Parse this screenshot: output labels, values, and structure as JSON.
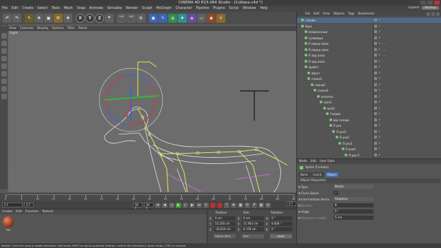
{
  "window": {
    "title": "CINEMA 4D R15.064 Studio - [Собака.c4d *]"
  },
  "menubar": [
    "File",
    "Edit",
    "Create",
    "Select",
    "Tools",
    "Mesh",
    "Snap",
    "Animate",
    "Simulate",
    "Render",
    "Sculpt",
    "MoGraph",
    "Character",
    "Pipeline",
    "Plugins",
    "Script",
    "Window",
    "Help"
  ],
  "layout": {
    "label": "Layout:",
    "value": "Startup"
  },
  "toolbar": {
    "axis_buttons": [
      "X",
      "Y",
      "Z"
    ]
  },
  "viewport": {
    "menu": [
      "View",
      "Cameras",
      "Display",
      "Options",
      "Filter",
      "Panel"
    ],
    "label": "Right"
  },
  "timeline": {
    "ticks": [
      "0",
      "5",
      "10",
      "15",
      "20",
      "25",
      "30",
      "35",
      "40",
      "45",
      "50",
      "55",
      "60",
      "65",
      "70",
      "75",
      "80",
      "85",
      "90"
    ],
    "current_frame_field": "0 F",
    "end_frame_field": "90 F",
    "start_field": "0 F",
    "max_field": "90 F",
    "right_field": "0 F"
  },
  "material_manager": {
    "menu": [
      "Create",
      "Edit",
      "Function",
      "Texture"
    ],
    "material_name": "Mat"
  },
  "coordinates": {
    "headers": [
      "Position",
      "Size",
      "Rotation"
    ],
    "axes": [
      "X",
      "Y",
      "Z"
    ],
    "position": [
      "0 cm",
      "55.256 cm",
      "-33.624 cm"
    ],
    "size": [
      "0 cm",
      "11.903 cm",
      "6.176 cm"
    ],
    "rotation_labels": [
      "H",
      "P",
      "B"
    ],
    "rotation": [
      "0 °",
      "6.628 °",
      "0 °"
    ],
    "mode_select": "Object (Rel)",
    "size_select": "Size",
    "apply_label": "Apply"
  },
  "statusbar": {
    "text": "Rotate: Click and drag to rotate elements. Hold down SHIFT to add to quantize rotation / add to the selection in point mode, CTRL to remove."
  },
  "object_manager": {
    "menu": [
      "File",
      "Edit",
      "View",
      "Objects",
      "Tags",
      "Bookmarks"
    ],
    "items": [
      {
        "name": "голова",
        "indent": 0,
        "tags": ""
      },
      {
        "name": "Root",
        "indent": 0,
        "tags": ""
      },
      {
        "name": "позвоночник",
        "indent": 1,
        "tags": ""
      },
      {
        "name": "туловище",
        "indent": 1,
        "tags": ""
      },
      {
        "name": "Л перед лапа",
        "indent": 1,
        "tags": "..."
      },
      {
        "name": "П перед лапа",
        "indent": 1,
        "tags": "..."
      },
      {
        "name": "Л зад лапа",
        "indent": 1,
        "tags": "..."
      },
      {
        "name": "П зад лапа",
        "indent": 1,
        "tags": "..."
      },
      {
        "name": "хребет",
        "indent": 1,
        "tags": ""
      },
      {
        "name": "Хвост",
        "indent": 2,
        "tags": ""
      },
      {
        "name": "спина1",
        "indent": 2,
        "tags": ""
      },
      {
        "name": "спина2",
        "indent": 3,
        "tags": ""
      },
      {
        "name": "спина3",
        "indent": 4,
        "tags": ""
      },
      {
        "name": "лопатка",
        "indent": 5,
        "tags": ""
      },
      {
        "name": "шея1",
        "indent": 6,
        "tags": ""
      },
      {
        "name": "шея2",
        "indent": 7,
        "tags": ""
      },
      {
        "name": "Голова",
        "indent": 8,
        "tags": ""
      },
      {
        "name": "low голова",
        "indent": 9,
        "tags": ""
      },
      {
        "name": "Л ухо",
        "indent": 9,
        "tags": ""
      },
      {
        "name": "Л ухо1",
        "indent": 10,
        "tags": ""
      },
      {
        "name": "Л ухо2",
        "indent": 11,
        "tags": ""
      },
      {
        "name": "Л ухо3",
        "indent": 12,
        "tags": ""
      },
      {
        "name": "Л ухо4",
        "indent": 13,
        "tags": ""
      },
      {
        "name": "Л ухо 5",
        "indent": 14,
        "tags": ""
      }
    ]
  },
  "attribute_manager": {
    "menu": [
      "Mode",
      "Edit",
      "User Data"
    ],
    "title": "Spline [Голова]",
    "tabs": [
      "Basic",
      "Coord.",
      "Object"
    ],
    "active_tab": "Object",
    "section": "Object Properties",
    "props": [
      {
        "label": "Type",
        "value": "Bezier",
        "dropdown": true,
        "dim": false
      },
      {
        "label": "Close Spline",
        "value": "✓",
        "dropdown": false,
        "dim": false
      },
      {
        "label": "Intermediate Points",
        "value": "Adaptive",
        "dropdown": true,
        "dim": false
      },
      {
        "label": "Number",
        "value": "8",
        "dropdown": false,
        "dim": true
      },
      {
        "label": "Angle",
        "value": "5 °",
        "dropdown": false,
        "dim": false
      },
      {
        "label": "Maximum Length",
        "value": "5 cm",
        "dropdown": false,
        "dim": true
      }
    ]
  },
  "colors": {
    "accent": "#3f6fb0",
    "axis_x": "#d23b3b",
    "axis_y": "#3ab53a",
    "axis_z": "#3c63d8",
    "joint": "#e8e85a",
    "spline": "#c46cd4"
  }
}
